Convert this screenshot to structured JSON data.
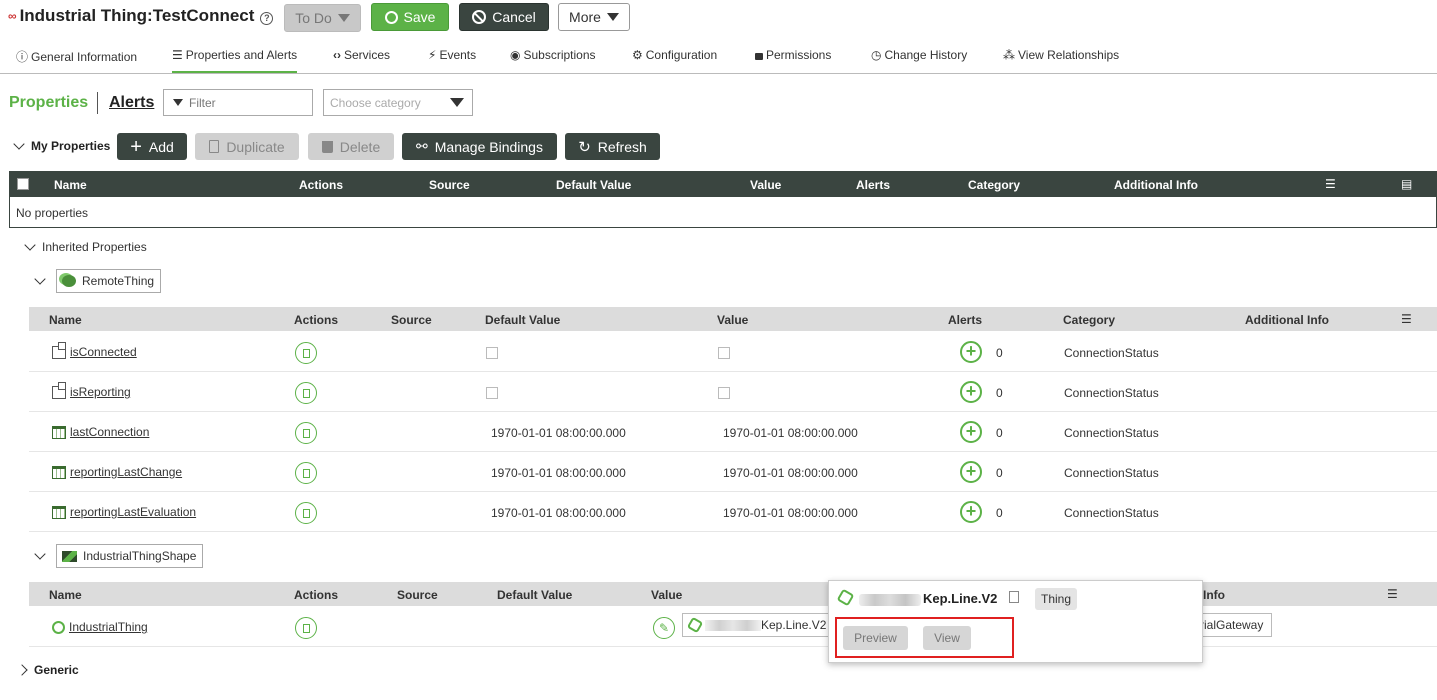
{
  "header": {
    "logo_text": "∞",
    "title": "Industrial Thing:TestConnect",
    "help_glyph": "?",
    "todo_label": "To Do",
    "save_label": "Save",
    "cancel_label": "Cancel",
    "more_label": "More"
  },
  "tabs": [
    {
      "label": "General Information",
      "icon": "info-icon",
      "glyph": "ⓘ"
    },
    {
      "label": "Properties and Alerts",
      "icon": "list-icon",
      "glyph": "☰"
    },
    {
      "label": "Services",
      "icon": "code-icon",
      "glyph": "‹›"
    },
    {
      "label": "Events",
      "icon": "lightning-icon",
      "glyph": "⚡"
    },
    {
      "label": "Subscriptions",
      "icon": "signal-icon",
      "glyph": "◉"
    },
    {
      "label": "Configuration",
      "icon": "gear-icon",
      "glyph": "⚙"
    },
    {
      "label": "Permissions",
      "icon": "lock-icon",
      "glyph": "🔒"
    },
    {
      "label": "Change History",
      "icon": "clock-icon",
      "glyph": "◷"
    },
    {
      "label": "View Relationships",
      "icon": "network-icon",
      "glyph": "⁂"
    }
  ],
  "subheader": {
    "properties_label": "Properties",
    "alerts_label": "Alerts",
    "filter_placeholder": "Filter",
    "category_placeholder": "Choose category"
  },
  "my_properties": {
    "label": "My Properties",
    "add_label": "Add",
    "duplicate_label": "Duplicate",
    "delete_label": "Delete",
    "manage_bindings_label": "Manage Bindings",
    "refresh_label": "Refresh",
    "columns": [
      "Name",
      "Actions",
      "Source",
      "Default Value",
      "Value",
      "Alerts",
      "Category",
      "Additional Info"
    ],
    "empty_text": "No properties"
  },
  "inherited": {
    "label": "Inherited Properties",
    "groups": [
      {
        "name": "RemoteThing",
        "columns": [
          "Name",
          "Actions",
          "Source",
          "Default Value",
          "Value",
          "Alerts",
          "Category",
          "Additional Info"
        ],
        "rows": [
          {
            "name": "isConnected",
            "type": "boolean",
            "default": "",
            "value": "",
            "alerts": "0",
            "category": "ConnectionStatus"
          },
          {
            "name": "isReporting",
            "type": "boolean",
            "default": "",
            "value": "",
            "alerts": "0",
            "category": "ConnectionStatus"
          },
          {
            "name": "lastConnection",
            "type": "datetime",
            "default": "1970-01-01 08:00:00.000",
            "value": "1970-01-01 08:00:00.000",
            "alerts": "0",
            "category": "ConnectionStatus"
          },
          {
            "name": "reportingLastChange",
            "type": "datetime",
            "default": "1970-01-01 08:00:00.000",
            "value": "1970-01-01 08:00:00.000",
            "alerts": "0",
            "category": "ConnectionStatus"
          },
          {
            "name": "reportingLastEvaluation",
            "type": "datetime",
            "default": "1970-01-01 08:00:00.000",
            "value": "1970-01-01 08:00:00.000",
            "alerts": "0",
            "category": "ConnectionStatus"
          }
        ]
      },
      {
        "name": "IndustrialThingShape",
        "columns": [
          "Name",
          "Actions",
          "Source",
          "Default Value",
          "Value",
          "Info"
        ],
        "rows": [
          {
            "name": "IndustrialThing",
            "value_text": "Kep.Line.V2",
            "info_text": "rialGateway"
          }
        ]
      }
    ]
  },
  "popup": {
    "thing_name": "Kep.Line.V2",
    "tag": "Thing",
    "preview_label": "Preview",
    "view_label": "View"
  },
  "generic_label": "Generic",
  "colors": {
    "accent": "#5cb247",
    "dark": "#3a4540",
    "highlight": "#e02020"
  }
}
